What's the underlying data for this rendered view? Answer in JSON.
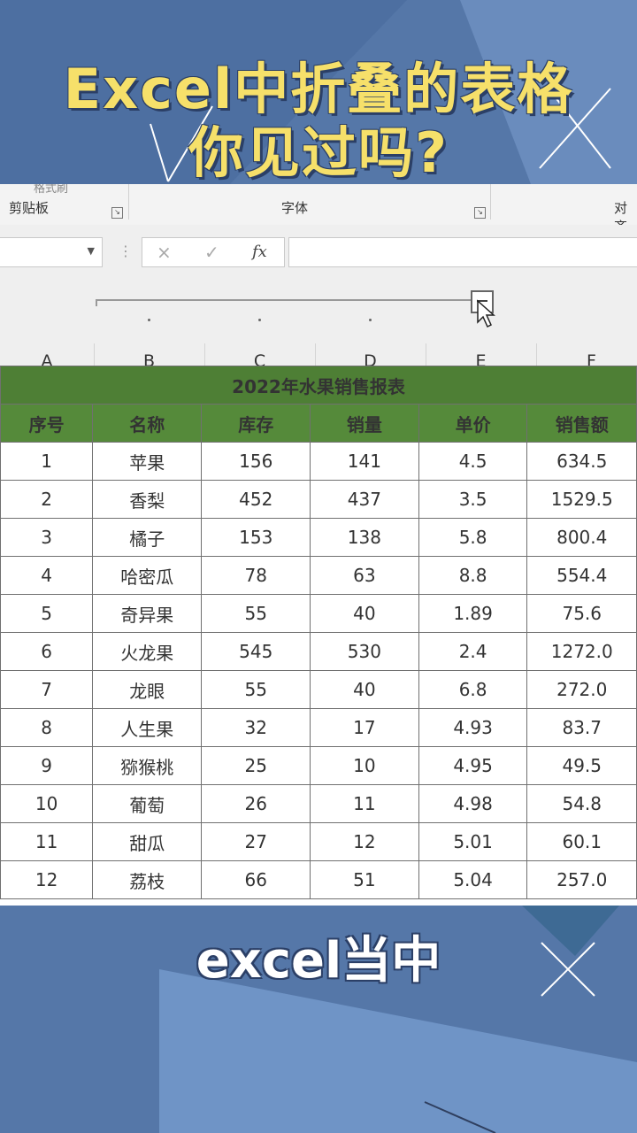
{
  "overlay": {
    "title_line1": "Excel中折叠的表格",
    "title_line2": "你见过吗?",
    "subtitle": "excel当中"
  },
  "ribbon": {
    "partial_label": "格式刷",
    "groups": [
      "剪贴板",
      "字体",
      "对齐"
    ]
  },
  "formula_bar": {
    "cancel_icon": "×",
    "enter_icon": "✓",
    "fx_label": "fx",
    "name_box_value": "",
    "formula_value": ""
  },
  "columns": [
    "A",
    "B",
    "C",
    "D",
    "E",
    "F"
  ],
  "sheet": {
    "title": "2022年水果销售报表",
    "headers": [
      "序号",
      "名称",
      "库存",
      "销量",
      "单价",
      "销售额"
    ],
    "rows": [
      [
        "1",
        "苹果",
        "156",
        "141",
        "4.5",
        "634.5"
      ],
      [
        "2",
        "香梨",
        "452",
        "437",
        "3.5",
        "1529.5"
      ],
      [
        "3",
        "橘子",
        "153",
        "138",
        "5.8",
        "800.4"
      ],
      [
        "4",
        "哈密瓜",
        "78",
        "63",
        "8.8",
        "554.4"
      ],
      [
        "5",
        "奇异果",
        "55",
        "40",
        "1.89",
        "75.6"
      ],
      [
        "6",
        "火龙果",
        "545",
        "530",
        "2.4",
        "1272.0"
      ],
      [
        "7",
        "龙眼",
        "55",
        "40",
        "6.8",
        "272.0"
      ],
      [
        "8",
        "人生果",
        "32",
        "17",
        "4.93",
        "83.7"
      ],
      [
        "9",
        "猕猴桃",
        "25",
        "10",
        "4.95",
        "49.5"
      ],
      [
        "10",
        "葡萄",
        "26",
        "11",
        "4.98",
        "54.8"
      ],
      [
        "11",
        "甜瓜",
        "27",
        "12",
        "5.01",
        "60.1"
      ],
      [
        "12",
        "荔枝",
        "66",
        "51",
        "5.04",
        "257.0"
      ]
    ]
  },
  "colors": {
    "banner_green": "#4e7f35",
    "header_green": "#558a3a",
    "background_blue": "#5577a8",
    "title_yellow": "#f6e06a"
  }
}
